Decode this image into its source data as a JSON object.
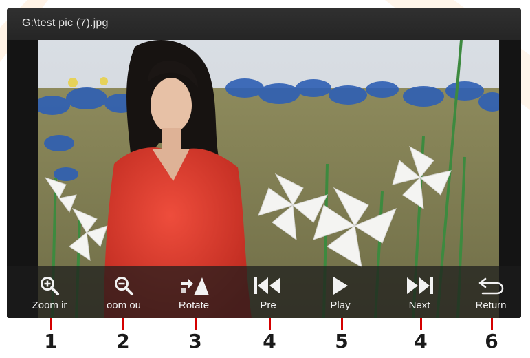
{
  "window": {
    "title": "G:\\test pic (7).jpg"
  },
  "toolbar": {
    "buttons": [
      {
        "label": "Zoom ir",
        "icon": "zoom-in-icon"
      },
      {
        "label": "oom ou",
        "icon": "zoom-out-icon"
      },
      {
        "label": "Rotate",
        "icon": "rotate-icon"
      },
      {
        "label": "Pre",
        "icon": "skip-previous-icon"
      },
      {
        "label": "Play",
        "icon": "play-icon"
      },
      {
        "label": "Next",
        "icon": "skip-next-icon"
      },
      {
        "label": "Return",
        "icon": "return-arrow-icon"
      }
    ]
  },
  "callouts": [
    "1",
    "2",
    "3",
    "4",
    "5",
    "4",
    "6"
  ],
  "colors": {
    "callout_line": "#d40000",
    "toolbar_text": "#f2f2f2",
    "title_text": "#e6e6e6"
  }
}
